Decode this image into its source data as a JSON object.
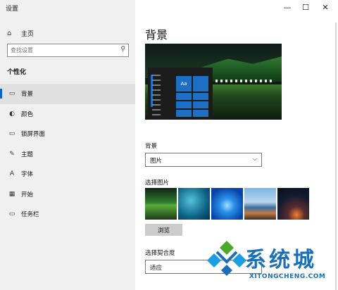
{
  "window": {
    "title": "设置",
    "minimize_glyph": "—",
    "maximize_glyph": "☐",
    "close_glyph": "✕"
  },
  "sidebar": {
    "home_label": "主页",
    "home_icon": "home-icon",
    "search_placeholder": "查找设置",
    "section_title": "个性化",
    "items": [
      {
        "label": "背景",
        "icon": "picture-icon",
        "glyph": "▭",
        "active": true
      },
      {
        "label": "颜色",
        "icon": "palette-icon",
        "glyph": "◐"
      },
      {
        "label": "锁屏界面",
        "icon": "lock-screen-icon",
        "glyph": "▭"
      },
      {
        "label": "主题",
        "icon": "theme-icon",
        "glyph": "✎"
      },
      {
        "label": "字体",
        "icon": "font-icon",
        "glyph": "A"
      },
      {
        "label": "开始",
        "icon": "start-icon",
        "glyph": "▦"
      },
      {
        "label": "任务栏",
        "icon": "taskbar-icon",
        "glyph": "▭"
      }
    ]
  },
  "main": {
    "page_title": "背景",
    "preview_tile_text": "Aa",
    "background_label": "背景",
    "background_value": "图片",
    "choose_picture_label": "选择图片",
    "browse_label": "浏览",
    "fit_label": "选择契合度",
    "fit_value": "适应"
  },
  "watermark": {
    "text": "系统城",
    "url": "XITONGCHENG.COM"
  },
  "colors": {
    "accent": "#0a64c8",
    "sidebar_bg": "#f0f0f0",
    "watermark_blue": "#1b6fb8",
    "watermark_green": "#4aa82a"
  }
}
